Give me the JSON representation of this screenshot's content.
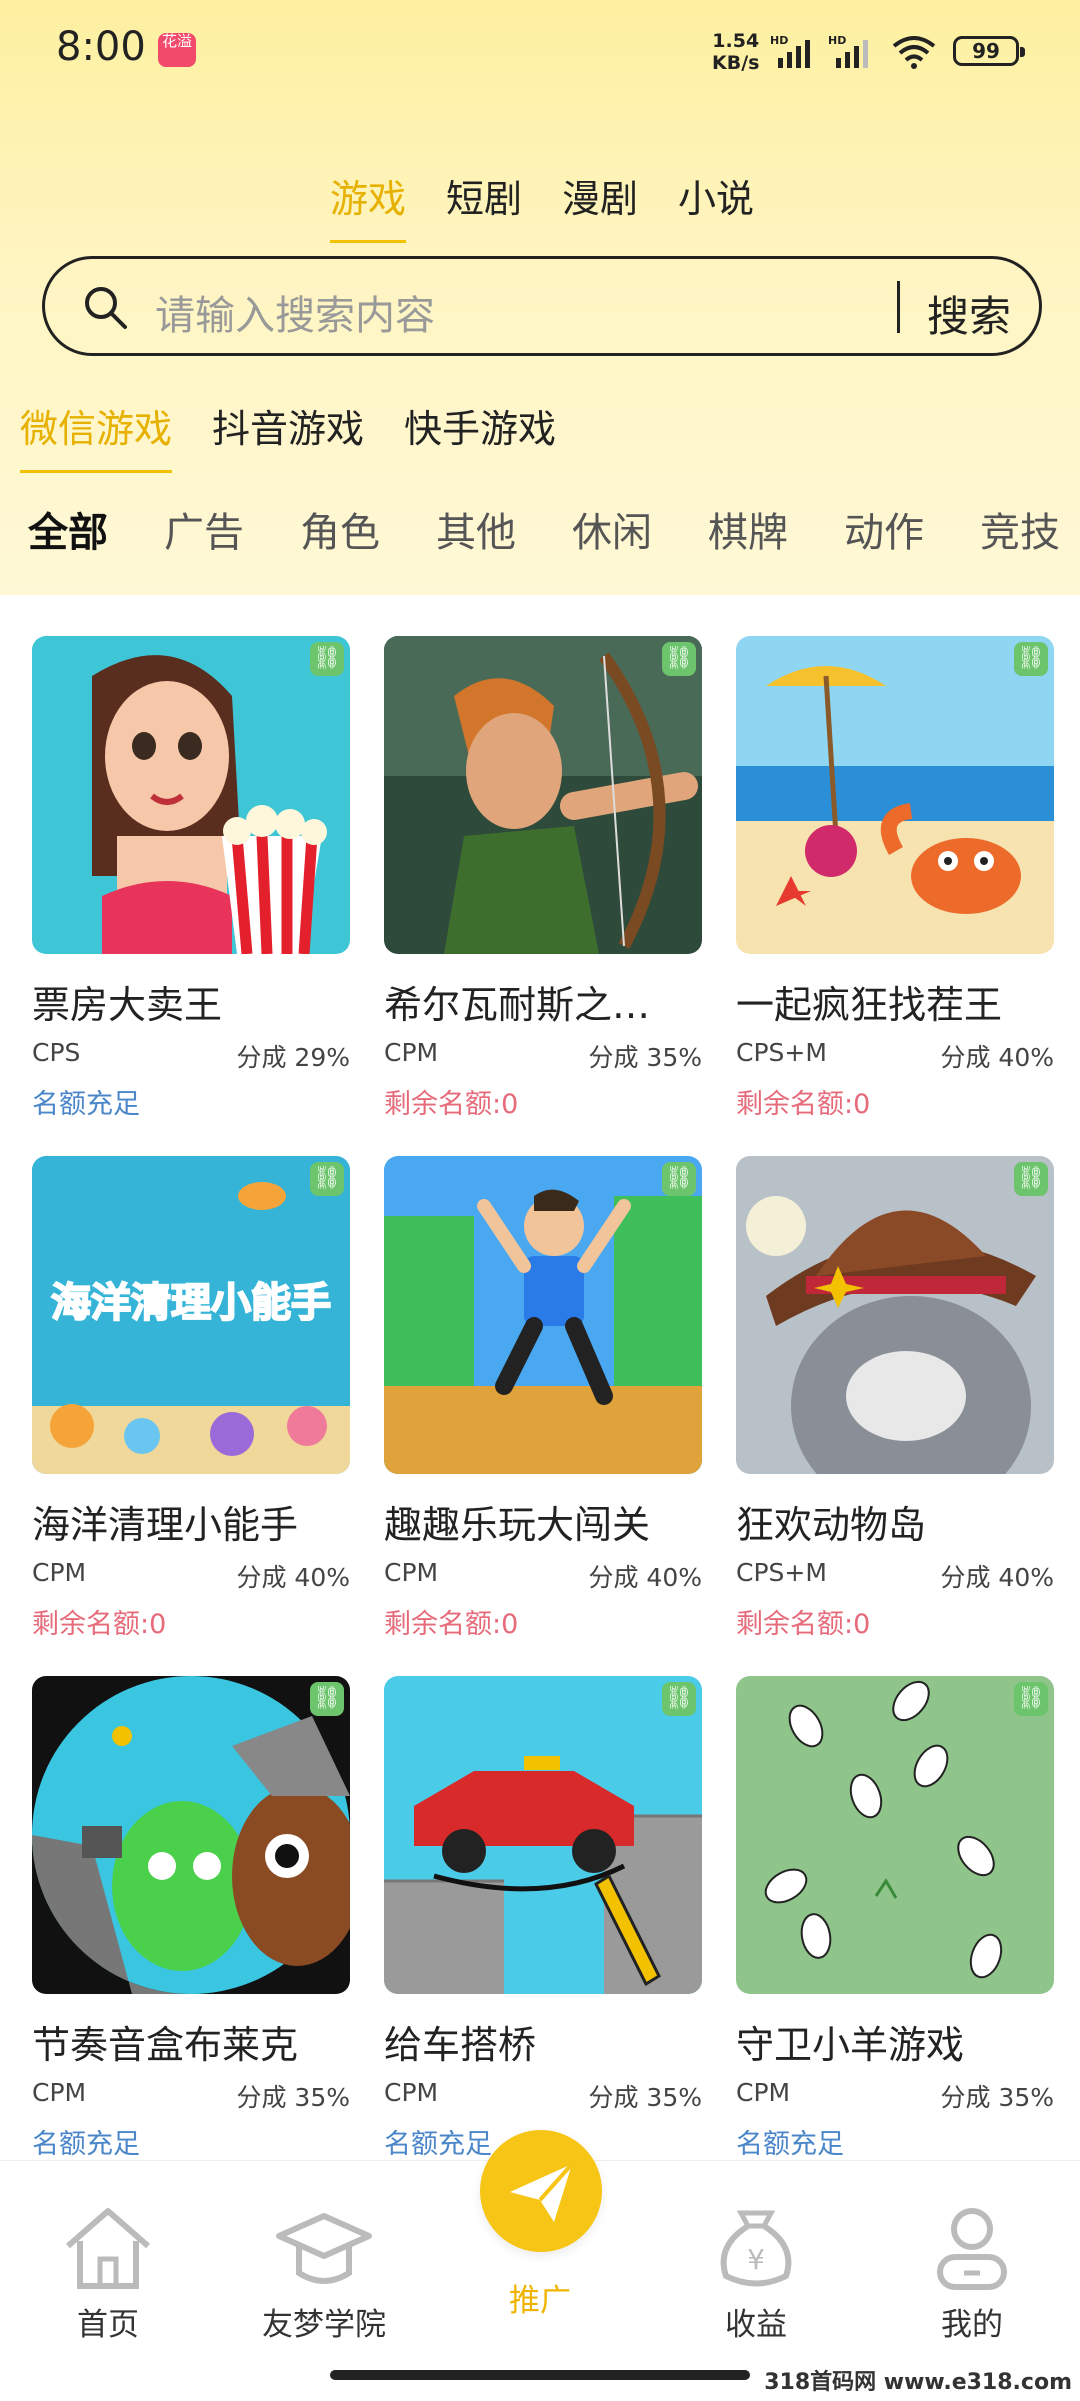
{
  "status_bar": {
    "time": "8:00",
    "app_badge": "花溢",
    "net_speed": "1.54",
    "net_unit": "KB/s",
    "hd1": "HD",
    "hd2": "HD",
    "battery": "99"
  },
  "content_tabs": [
    {
      "label": "游戏",
      "active": true
    },
    {
      "label": "短剧",
      "active": false
    },
    {
      "label": "漫剧",
      "active": false
    },
    {
      "label": "小说",
      "active": false
    }
  ],
  "search": {
    "placeholder": "请输入搜索内容",
    "button": "搜索"
  },
  "platform_tabs": [
    {
      "label": "微信游戏",
      "active": true
    },
    {
      "label": "抖音游戏",
      "active": false
    },
    {
      "label": "快手游戏",
      "active": false
    }
  ],
  "game_categories": [
    "全部",
    "广告",
    "角色",
    "其他",
    "休闲",
    "棋牌",
    "动作",
    "竞技"
  ],
  "games": [
    {
      "name": "票房大卖王",
      "type": "CPS",
      "share": "分成 29%",
      "quota": "名额充足",
      "quota_ok": true,
      "art": "popcorn"
    },
    {
      "name": "希尔瓦耐斯之…",
      "type": "CPM",
      "share": "分成 35%",
      "quota": "剩余名额:0",
      "quota_ok": false,
      "art": "archer"
    },
    {
      "name": "一起疯狂找茬王",
      "type": "CPS+M",
      "share": "分成 40%",
      "quota": "剩余名额:0",
      "quota_ok": false,
      "art": "beach"
    },
    {
      "name": "海洋清理小能手",
      "type": "CPM",
      "share": "分成 40%",
      "quota": "剩余名额:0",
      "quota_ok": false,
      "art": "ocean",
      "art_text": "海洋清理小能手"
    },
    {
      "name": "趣趣乐玩大闯关",
      "type": "CPM",
      "share": "分成 40%",
      "quota": "剩余名额:0",
      "quota_ok": false,
      "art": "jump"
    },
    {
      "name": "狂欢动物岛",
      "type": "CPS+M",
      "share": "分成 40%",
      "quota": "剩余名额:0",
      "quota_ok": false,
      "art": "cat"
    },
    {
      "name": "节奏音盒布莱克",
      "type": "CPM",
      "share": "分成 35%",
      "quota": "名额充足",
      "quota_ok": true,
      "art": "music"
    },
    {
      "name": "给车搭桥",
      "type": "CPM",
      "share": "分成 35%",
      "quota": "名额充足",
      "quota_ok": true,
      "art": "car"
    },
    {
      "name": "守卫小羊游戏",
      "type": "CPM",
      "share": "分成 35%",
      "quota": "名额充足",
      "quota_ok": true,
      "art": "sheep"
    }
  ],
  "bottom_nav": [
    {
      "label": "首页",
      "icon": "home-icon",
      "active": false
    },
    {
      "label": "友梦学院",
      "icon": "graduation-cap-icon",
      "active": false
    },
    {
      "label": "推广",
      "icon": "paper-plane-icon",
      "active": true
    },
    {
      "label": "收益",
      "icon": "money-bag-icon",
      "active": false
    },
    {
      "label": "我的",
      "icon": "user-icon",
      "active": false
    }
  ],
  "watermark": "318首码网 www.e318.com",
  "colors": {
    "accent": "#f2c200",
    "quota_ok": "#4a86c8",
    "quota_no": "#e66a7a",
    "header_bg": "#fff3b8"
  }
}
